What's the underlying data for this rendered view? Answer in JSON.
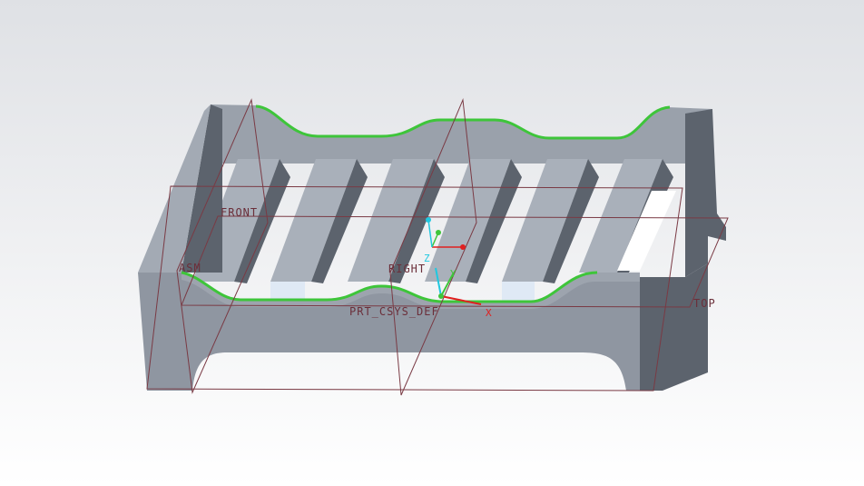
{
  "viewport": {
    "datum_planes": {
      "front": "FRONT",
      "side": "ASM",
      "right": "RIGHT",
      "top": "TOP"
    },
    "coordinate_system": "PRT_CSYS_DEF",
    "axes": {
      "x": "X",
      "y": "Y",
      "z": "Z"
    }
  },
  "colors": {
    "background_top": "#dfe1e5",
    "model_top": "#99a0aa",
    "model_front": "#8f96a1",
    "model_dark": "#5c636d",
    "edge_highlight": "#3ec53a",
    "datum": "#7a3a44",
    "axis_x": "#e02020",
    "axis_y": "#3ec53a",
    "axis_z": "#20c8e0"
  }
}
